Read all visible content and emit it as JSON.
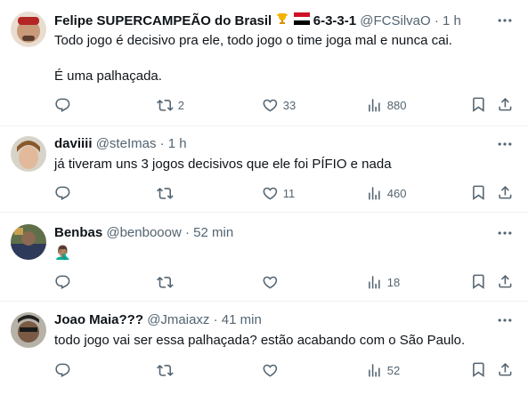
{
  "tweets": [
    {
      "name": "Felipe SUPERCAMPEÃO do Brasil",
      "name_suffix": "6-3-3-1",
      "handle": "@FCSilvaO",
      "time": "· 1 h",
      "text": "Todo jogo é decisivo pra ele, todo jogo o time joga mal e nunca cai.\n\nÉ uma palhaçada.",
      "replies": "",
      "retweets": "2",
      "likes": "33",
      "views": "880"
    },
    {
      "name": "daviiii",
      "handle": "@steImas",
      "time": "· 1 h",
      "text": "já tiveram uns 3 jogos decisivos que ele foi PÍFIO e nada",
      "replies": "",
      "retweets": "",
      "likes": "11",
      "views": "460"
    },
    {
      "name": "Benbas",
      "handle": "@benbooow",
      "time": "· 52 min",
      "text": "🤦🏽‍♂️",
      "replies": "",
      "retweets": "",
      "likes": "",
      "views": "18"
    },
    {
      "name": "Joao Maia???",
      "handle": "@Jmaiaxz",
      "time": "· 41 min",
      "text": "todo jogo vai ser essa palhaçada? estão acabando com o São Paulo.",
      "replies": "",
      "retweets": "",
      "likes": "",
      "views": "52"
    }
  ],
  "icons": {
    "trophy": "trophy-icon",
    "flag": "flag-icon",
    "reply": "reply-icon",
    "retweet": "retweet-icon",
    "like": "heart-icon",
    "views": "views-icon",
    "bookmark": "bookmark-icon",
    "share": "share-icon",
    "more": "more-icon"
  },
  "colors": {
    "text": "#0f1419",
    "secondary": "#536471",
    "divider": "#eff3f4"
  }
}
